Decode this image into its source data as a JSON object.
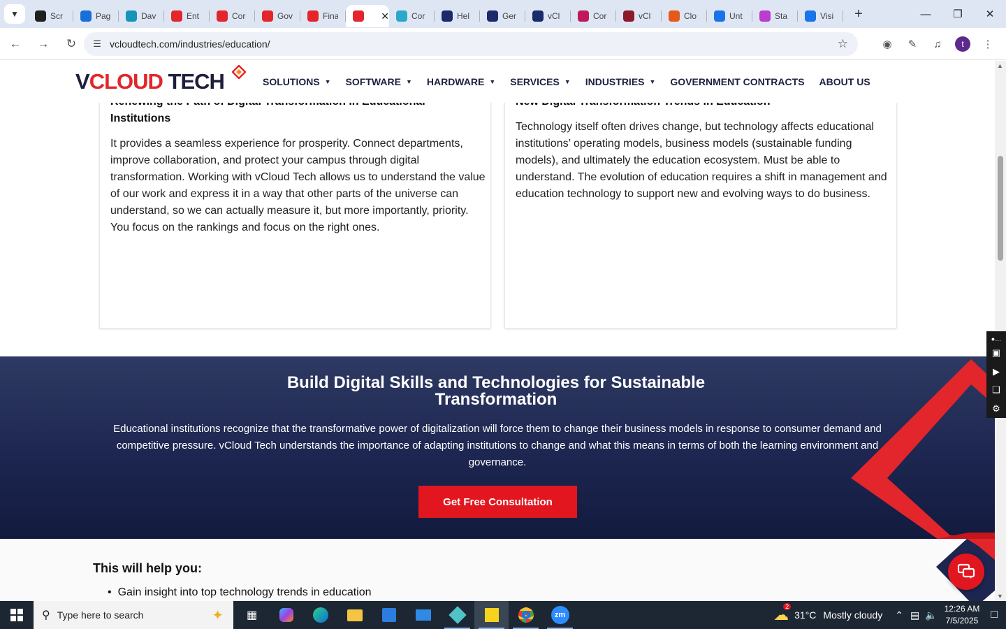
{
  "browser": {
    "tabs": [
      {
        "label": "Scr",
        "color": "#1f1f1f"
      },
      {
        "label": "Pag",
        "color": "#1a6fd6"
      },
      {
        "label": "Dav",
        "color": "#1596b9"
      },
      {
        "label": "Ent",
        "color": "#e3262b"
      },
      {
        "label": "Cor",
        "color": "#e3262b"
      },
      {
        "label": "Gov",
        "color": "#e3262b"
      },
      {
        "label": "Fina",
        "color": "#e3262b"
      },
      {
        "label": "",
        "color": "#e3262b",
        "active": true
      },
      {
        "label": "Cor",
        "color": "#2aa8c9"
      },
      {
        "label": "Hel",
        "color": "#1b2a6b"
      },
      {
        "label": "Ger",
        "color": "#1b2a6b"
      },
      {
        "label": "vCl",
        "color": "#1b2a6b"
      },
      {
        "label": "Cor",
        "color": "#c2185b"
      },
      {
        "label": "vCl",
        "color": "#8b1a2b"
      },
      {
        "label": "Clo",
        "color": "#e55a1b"
      },
      {
        "label": "Unt",
        "color": "#1a73e8"
      },
      {
        "label": "Sta",
        "color": "#b83dd0"
      },
      {
        "label": "Visi",
        "color": "#1a73e8"
      }
    ],
    "url": "vcloudtech.com/industries/education/",
    "avatar_letter": "t"
  },
  "header": {
    "logo": {
      "v": "V",
      "cloud": "CLOUD",
      "tech": " TECH"
    },
    "nav": [
      {
        "label": "SOLUTIONS",
        "dropdown": true
      },
      {
        "label": "SOFTWARE",
        "dropdown": true
      },
      {
        "label": "HARDWARE",
        "dropdown": true
      },
      {
        "label": "SERVICES",
        "dropdown": true
      },
      {
        "label": "INDUSTRIES",
        "dropdown": true
      },
      {
        "label": "GOVERNMENT CONTRACTS",
        "dropdown": false
      },
      {
        "label": "ABOUT US",
        "dropdown": false
      }
    ]
  },
  "cards": {
    "left": {
      "title": "Renewing the Path of Digital Transformation in Educational Institutions",
      "body": "It provides a seamless experience for prosperity. Connect departments, improve collaboration, and protect your campus through digital transformation. Working with vCloud Tech allows us to understand the value of our work and express it in a way that other parts of the universe can understand, so we can actually measure it, but more importantly, priority. You focus on the rankings and focus on the right ones."
    },
    "right": {
      "title": "New Digital Transformation Trends in Education",
      "body": "Technology itself often drives change, but technology affects educational institutions’ operating models, business models (sustainable funding models), and ultimately the education ecosystem. Must be able to understand. The evolution of education requires a shift in management and education technology to support new and evolving ways to do business."
    }
  },
  "banner": {
    "title": "Build Digital Skills and Technologies for Sustainable Transformation",
    "text": "Educational institutions recognize that the transformative power of digitalization will force them to change their business models in response to consumer demand and competitive pressure. vCloud Tech understands the importance of adapting institutions to change and what this means in terms of both the learning environment and governance.",
    "cta": "Get Free Consultation"
  },
  "help": {
    "title": "This will help you:",
    "items": [
      "Gain insight into top technology trends in education"
    ]
  },
  "taskbar": {
    "search_placeholder": "Type here to search",
    "weather": {
      "temp": "31°C",
      "desc": "Mostly cloudy",
      "badge": "2"
    },
    "time": "12:26 AM",
    "date": "7/5/2025"
  }
}
